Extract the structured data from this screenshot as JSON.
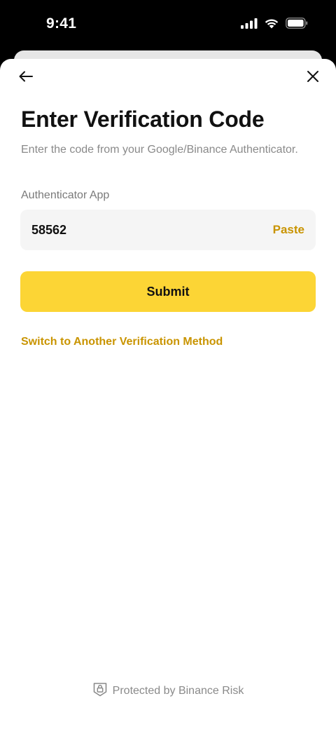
{
  "status_bar": {
    "time": "9:41",
    "icons": [
      "cellular-signal-icon",
      "wifi-icon",
      "battery-icon"
    ]
  },
  "nav": {
    "back_icon": "arrow-left-icon",
    "close_icon": "close-icon"
  },
  "page": {
    "title": "Enter Verification Code",
    "subtitle": "Enter the code from your Google/Binance Authenticator."
  },
  "form": {
    "field_label": "Authenticator App",
    "code_value": "58562",
    "paste_label": "Paste",
    "submit_label": "Submit",
    "switch_method_label": "Switch to Another Verification Method"
  },
  "footer": {
    "icon": "shield-lock-icon",
    "text": "Protected by Binance Risk"
  },
  "colors": {
    "accent_yellow": "#fcd535",
    "link_gold": "#c99400",
    "text_dark": "#111111",
    "text_muted": "#8a8a8a",
    "input_bg": "#f5f5f5"
  }
}
